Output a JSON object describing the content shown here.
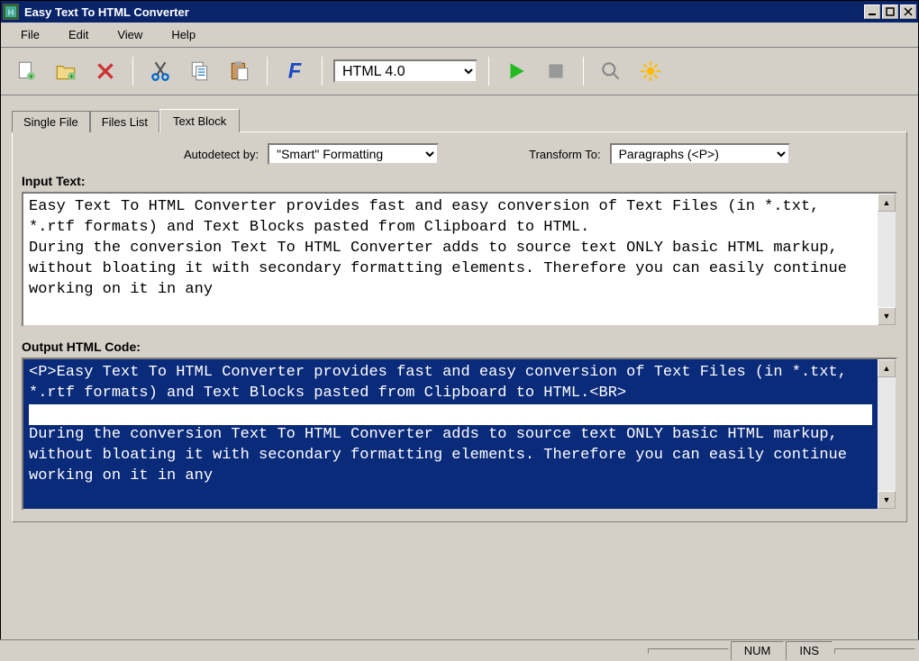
{
  "window": {
    "title": "Easy Text To HTML Converter"
  },
  "menubar": {
    "items": [
      "File",
      "Edit",
      "View",
      "Help"
    ]
  },
  "toolbar": {
    "format_select": "HTML 4.0"
  },
  "tabs": {
    "items": [
      "Single File",
      "Files List",
      "Text Block"
    ],
    "active": "Text Block"
  },
  "options": {
    "autodetect_label": "Autodetect by:",
    "autodetect_value": "\"Smart\" Formatting",
    "transform_label": "Transform To:",
    "transform_value": "Paragraphs (<P>)"
  },
  "input": {
    "label": "Input Text:",
    "text": "Easy Text To HTML Converter provides fast and easy conversion of Text Files (in *.txt, *.rtf formats) and Text Blocks pasted from Clipboard to HTML.\nDuring the conversion Text To HTML Converter adds to source text ONLY basic HTML markup, without bloating it with secondary formatting elements. Therefore you can easily continue working on it in any"
  },
  "output": {
    "label": "Output HTML Code:",
    "text_selected": "<P>Easy Text To HTML Converter provides fast and easy conversion of Text Files (in *.txt, *.rtf formats) and Text Blocks pasted from Clipboard to HTML.<BR>",
    "text_rest": "During the conversion Text To HTML Converter adds to source text ONLY basic HTML markup, without bloating it with secondary formatting elements. Therefore you can easily continue working on it in any"
  },
  "statusbar": {
    "num": "NUM",
    "ins": "INS"
  }
}
